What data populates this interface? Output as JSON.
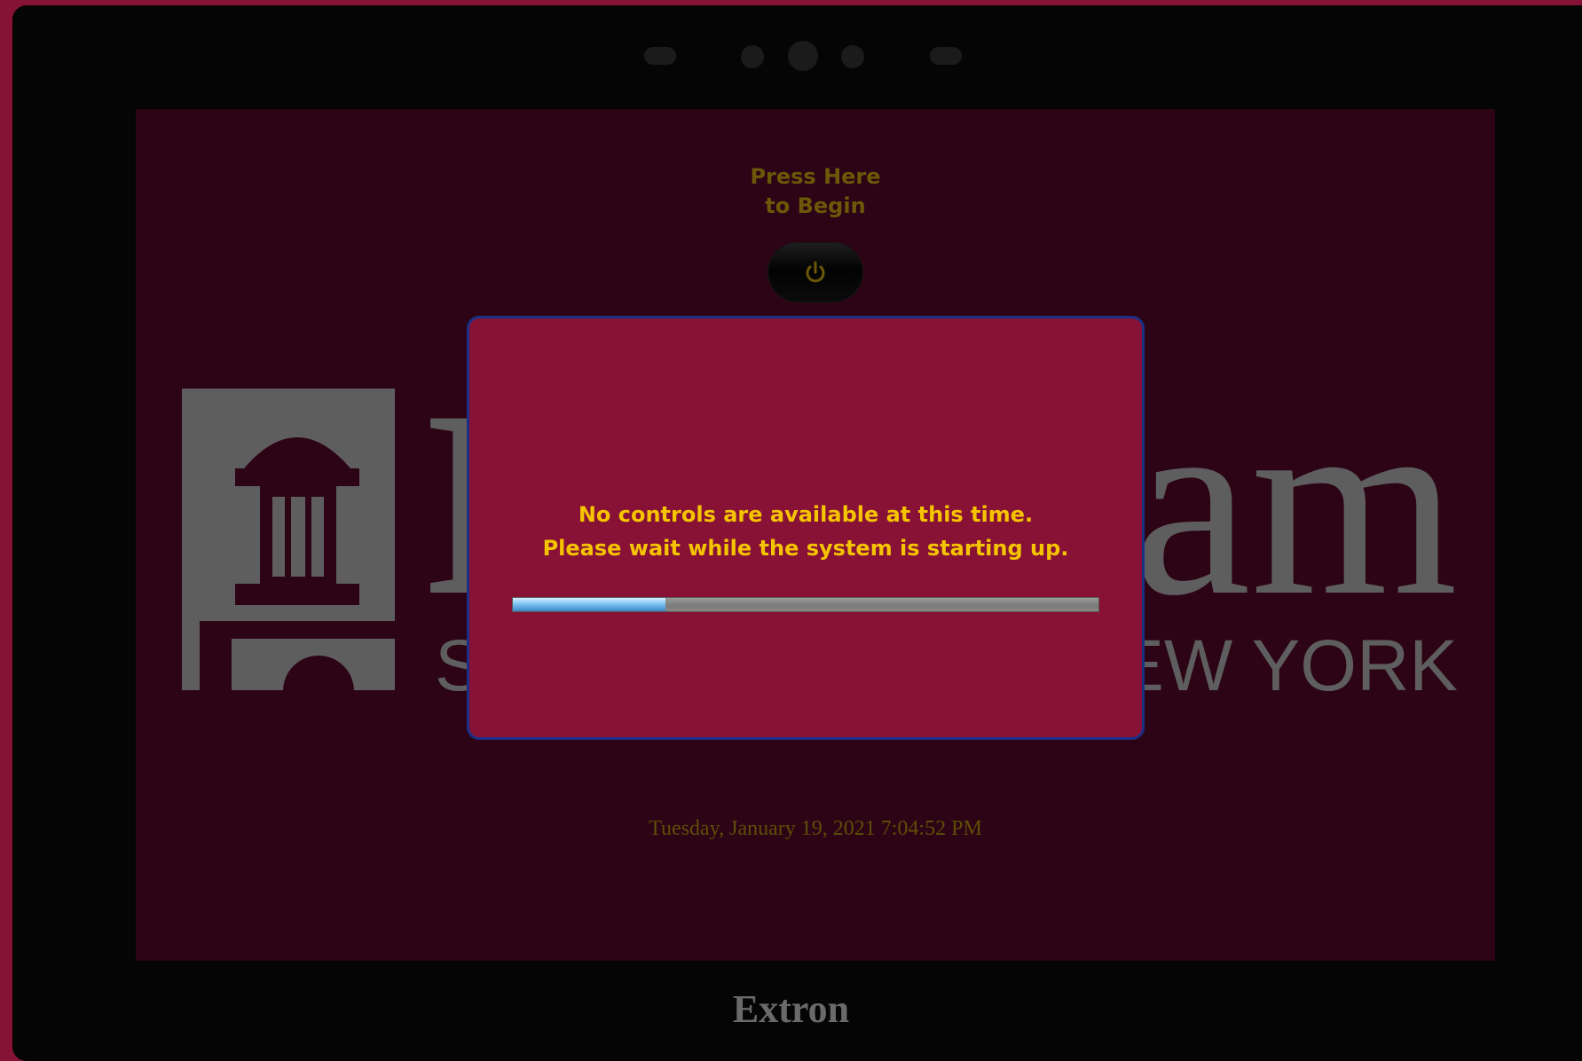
{
  "screen": {
    "press_label": "Press Here\nto Begin",
    "power_button_icon": "power-icon",
    "datetime": "Tuesday, January 19, 2021 7:04:52 PM",
    "logo": {
      "word_fragment_left": "I",
      "word_fragment_right": "am",
      "subtitle_left": "ST",
      "subtitle_right": "NEW YORK"
    }
  },
  "modal": {
    "message": "No controls are available at this time.\nPlease wait while the system is starting up.",
    "progress": 0.26
  },
  "device": {
    "brand": "Extron"
  },
  "colors": {
    "accent": "#f5c400",
    "modal_bg": "#881236",
    "screen_bg": "#2c0415",
    "border_blue": "#1b2f86"
  }
}
